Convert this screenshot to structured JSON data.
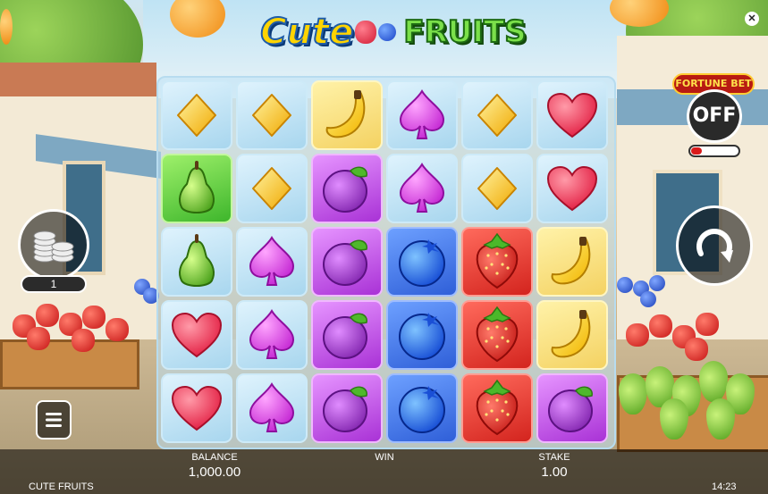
{
  "game": {
    "logo_word1": "Cute",
    "logo_word2": "FRUITS",
    "name": "CUTE FRUITS",
    "clock": "14:23"
  },
  "fortune_bet": {
    "label": "FORTUNE BET",
    "state": "OFF"
  },
  "coins": {
    "value": "1"
  },
  "stats": {
    "balance_label": "BALANCE",
    "balance_value": "1,000.00",
    "win_label": "WIN",
    "win_value": "",
    "stake_label": "STAKE",
    "stake_value": "1.00"
  },
  "colors": {
    "ice": "#a8d6ee",
    "yellow": "#f4d262",
    "green": "#3eb62c",
    "purple": "#a932d6",
    "blue": "#2f5fd8",
    "red": "#d3241e"
  },
  "reels": [
    [
      {
        "symbol": "diamond",
        "bg": "ice"
      },
      {
        "symbol": "pear",
        "bg": "green"
      },
      {
        "symbol": "pear",
        "bg": "ice"
      },
      {
        "symbol": "heart",
        "bg": "ice"
      },
      {
        "symbol": "heart",
        "bg": "ice"
      }
    ],
    [
      {
        "symbol": "diamond",
        "bg": "ice"
      },
      {
        "symbol": "diamond",
        "bg": "ice"
      },
      {
        "symbol": "spade",
        "bg": "ice"
      },
      {
        "symbol": "spade",
        "bg": "ice"
      },
      {
        "symbol": "spade",
        "bg": "ice"
      }
    ],
    [
      {
        "symbol": "banana",
        "bg": "yellow"
      },
      {
        "symbol": "plum",
        "bg": "purple"
      },
      {
        "symbol": "plum",
        "bg": "purple"
      },
      {
        "symbol": "plum",
        "bg": "purple"
      },
      {
        "symbol": "plum",
        "bg": "purple"
      }
    ],
    [
      {
        "symbol": "spade",
        "bg": "ice"
      },
      {
        "symbol": "spade",
        "bg": "ice"
      },
      {
        "symbol": "blueberry",
        "bg": "blue"
      },
      {
        "symbol": "blueberry",
        "bg": "blue"
      },
      {
        "symbol": "blueberry",
        "bg": "blue"
      }
    ],
    [
      {
        "symbol": "diamond",
        "bg": "ice"
      },
      {
        "symbol": "diamond",
        "bg": "ice"
      },
      {
        "symbol": "strawberry",
        "bg": "red"
      },
      {
        "symbol": "strawberry",
        "bg": "red"
      },
      {
        "symbol": "strawberry",
        "bg": "red"
      }
    ],
    [
      {
        "symbol": "heart",
        "bg": "ice"
      },
      {
        "symbol": "heart",
        "bg": "ice"
      },
      {
        "symbol": "banana",
        "bg": "yellow"
      },
      {
        "symbol": "banana",
        "bg": "yellow"
      },
      {
        "symbol": "plum",
        "bg": "purple"
      }
    ]
  ]
}
